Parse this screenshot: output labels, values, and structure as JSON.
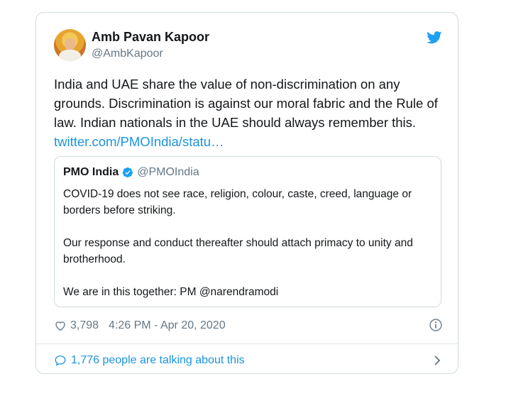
{
  "tweet": {
    "author_name": "Amb Pavan Kapoor",
    "author_handle": "@AmbKapoor",
    "text": "India and UAE share the value of non-discrimination on any grounds.  Discrimination is against our moral fabric and the Rule of law. Indian nationals in the UAE should always remember this. ",
    "link_text": "twitter.com/PMOIndia/statu…",
    "brand_color": "#1da1f2",
    "link_color": "#1b95e0"
  },
  "quoted": {
    "author_name": "PMO India",
    "author_handle": "@PMOIndia",
    "paragraphs": [
      "COVID-19 does not see race, religion, colour, caste, creed, language or borders before striking.",
      "Our response and conduct thereafter should attach primacy to unity and brotherhood.",
      "We are in this together: PM @narendramodi"
    ]
  },
  "meta": {
    "likes": "3,798",
    "timestamp": "4:26 PM - Apr 20, 2020"
  },
  "footer": {
    "talking_text": "1,776 people are talking about this"
  },
  "icons": [
    "twitter-bird-icon",
    "verified-badge-icon",
    "heart-icon",
    "info-icon",
    "speech-bubble-icon",
    "chevron-right-icon"
  ]
}
